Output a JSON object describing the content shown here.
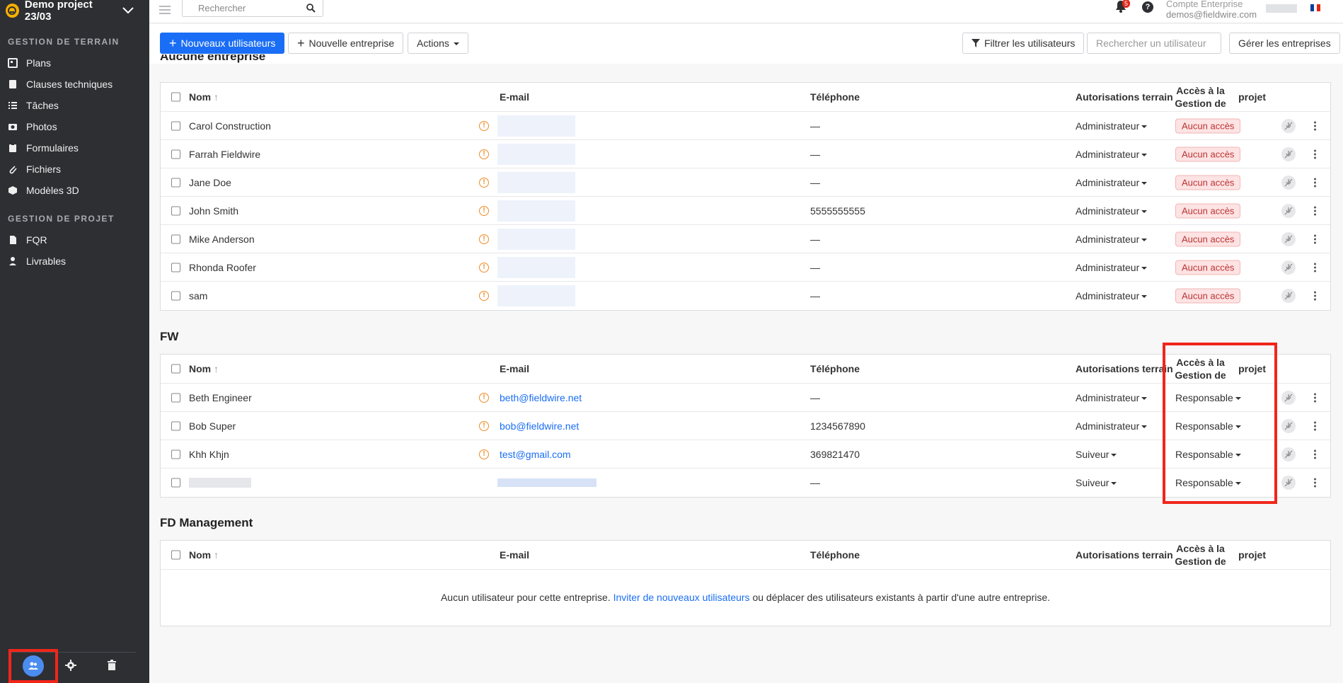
{
  "project": {
    "name": "Demo project 23/03"
  },
  "sidebar": {
    "section1": "GESTION DE TERRAIN",
    "items1": [
      "Plans",
      "Clauses techniques",
      "Tâches",
      "Photos",
      "Formulaires",
      "Fichiers",
      "Modèles 3D"
    ],
    "section2": "GESTION DE PROJET",
    "items2": [
      "FQR",
      "Livrables"
    ]
  },
  "topbar": {
    "search_placeholder": "Rechercher",
    "notif_count": "5",
    "account_title": "Compte Enterprise",
    "account_email": "demos@fieldwire.com"
  },
  "actions": {
    "new_users": "Nouveaux utilisateurs",
    "new_company": "Nouvelle entreprise",
    "actions": "Actions",
    "filter": "Filtrer les utilisateurs",
    "search_user_placeholder": "Rechercher un utilisateur",
    "manage": "Gérer les entreprises"
  },
  "columns": {
    "name": "Nom",
    "email": "E-mail",
    "phone": "Téléphone",
    "perm": "Autorisations terrain",
    "access_line1": "Accès à la Gestion de",
    "access_line2": "projet"
  },
  "sections": {
    "none": {
      "title": "Aucune entreprise",
      "rows": [
        {
          "name": "Carol Construction",
          "phone": "—",
          "perm": "Administrateur",
          "access": "Aucun accès"
        },
        {
          "name": "Farrah Fieldwire",
          "phone": "—",
          "perm": "Administrateur",
          "access": "Aucun accès"
        },
        {
          "name": "Jane Doe",
          "phone": "—",
          "perm": "Administrateur",
          "access": "Aucun accès"
        },
        {
          "name": "John Smith",
          "phone": "5555555555",
          "perm": "Administrateur",
          "access": "Aucun accès"
        },
        {
          "name": "Mike Anderson",
          "phone": "—",
          "perm": "Administrateur",
          "access": "Aucun accès"
        },
        {
          "name": "Rhonda Roofer",
          "phone": "—",
          "perm": "Administrateur",
          "access": "Aucun accès"
        },
        {
          "name": "sam",
          "phone": "—",
          "perm": "Administrateur",
          "access": "Aucun accès"
        }
      ]
    },
    "fw": {
      "title": "FW",
      "rows": [
        {
          "name": "Beth Engineer",
          "email": "beth@fieldwire.net",
          "phone": "—",
          "perm": "Administrateur",
          "access": "Responsable"
        },
        {
          "name": "Bob Super",
          "email": "bob@fieldwire.net",
          "phone": "1234567890",
          "perm": "Administrateur",
          "access": "Responsable"
        },
        {
          "name": "Khh Khjn",
          "email": "test@gmail.com",
          "phone": "369821470",
          "perm": "Suiveur",
          "access": "Responsable"
        },
        {
          "name": "",
          "email": "",
          "phone": "—",
          "perm": "Suiveur",
          "access": "Responsable"
        }
      ]
    },
    "fd": {
      "title": "FD Management",
      "empty_text1": "Aucun utilisateur pour cette entreprise.",
      "empty_link": "Inviter de nouveaux utilisateurs",
      "empty_text2": "ou déplacer des utilisateurs existants à partir d'une autre entreprise."
    }
  }
}
